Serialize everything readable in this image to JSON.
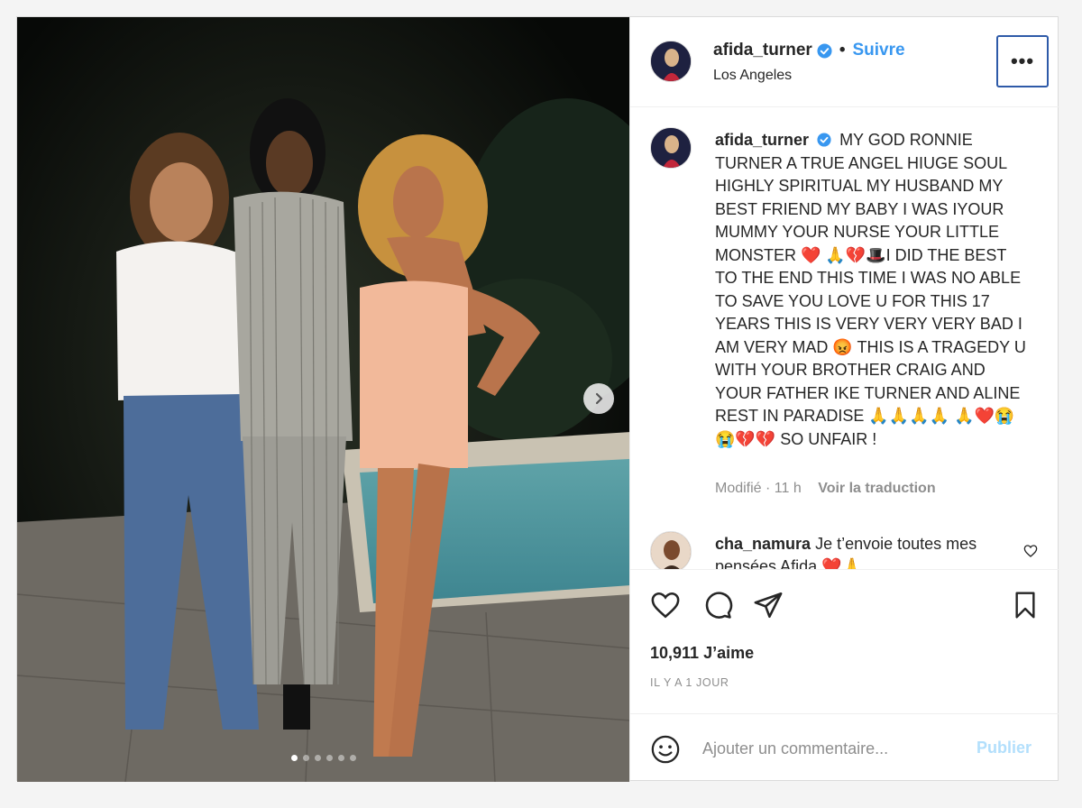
{
  "post": {
    "username": "afida_turner",
    "follow_label": "Suivre",
    "separator": "•",
    "location": "Los Angeles",
    "more_label": "•••",
    "carousel": {
      "slide_count": 6,
      "active_index": 0
    }
  },
  "caption": {
    "username": "afida_turner",
    "text": "MY GOD RONNIE TURNER A TRUE ANGEL HIUGE SOUL HIGHLY SPIRITUAL MY HUSBAND MY BEST FRIEND MY BABY I WAS IYOUR MUMMY YOUR NURSE YOUR LITTLE MONSTER ❤️ 🙏💔🎩I DID THE BEST TO THE END THIS TIME I WAS NO ABLE TO SAVE YOU LOVE U FOR THIS 17 YEARS THIS IS VERY VERY VERY BAD I AM VERY MAD 😡 THIS IS A TRAGEDY U WITH YOUR BROTHER CRAIG AND YOUR FATHER IKE TURNER AND ALINE REST IN PARADISE 🙏🙏🙏🙏 🙏❤️😭😭💔💔 SO UNFAIR !",
    "edited": "Modifié · 11 h",
    "translate": "Voir la traduction"
  },
  "comments": [
    {
      "username": "cha_namura",
      "text": "Je t’envoie toutes mes pensées Afida ❤️🙏"
    }
  ],
  "stats": {
    "likes": "10,911 J’aime",
    "time_ago": "IL Y A 1 JOUR"
  },
  "composer": {
    "placeholder": "Ajouter un commentaire...",
    "publish_label": "Publier"
  },
  "colors": {
    "accent": "#3897f0",
    "publish_disabled": "#b2dffc",
    "verified": "#3897f0"
  },
  "icons": [
    "chevron-right-icon",
    "verified-badge-icon",
    "heart-icon",
    "comment-icon",
    "share-icon",
    "bookmark-icon",
    "emoji-icon"
  ]
}
